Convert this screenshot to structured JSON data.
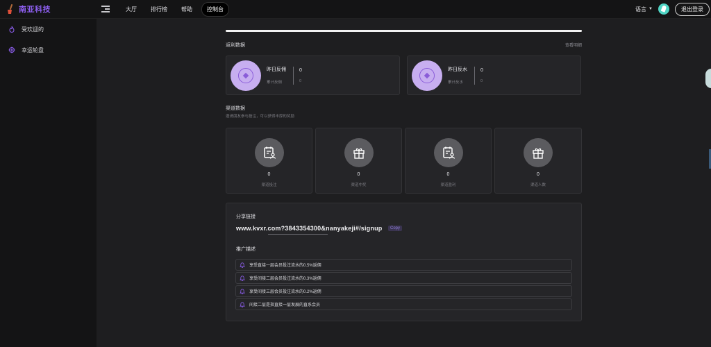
{
  "header": {
    "brand_name": "南亚科技",
    "nav": [
      {
        "label": "大厅",
        "active": false
      },
      {
        "label": "排行榜",
        "active": false
      },
      {
        "label": "帮助",
        "active": false
      },
      {
        "label": "控制台",
        "active": true
      }
    ],
    "language_label": "语言",
    "logout_label": "退出登录"
  },
  "sidebar": {
    "items": [
      {
        "label": "受欢迎的",
        "icon": "flame-icon"
      },
      {
        "label": "幸运轮盘",
        "icon": "wheel-icon"
      }
    ]
  },
  "main": {
    "progress": 1.0,
    "rebate_section": {
      "title": "返利数据",
      "detail_link": "查看明细",
      "cards": [
        {
          "label": "昨日反佣",
          "sub_label": "累计反佣",
          "value": "0",
          "total": "0"
        },
        {
          "label": "昨日反水",
          "sub_label": "累计反水",
          "value": "0",
          "total": "0"
        }
      ]
    },
    "channel_section": {
      "title": "渠道数据",
      "subtitle": "邀请朋友参与投注，可以获得丰厚的奖励",
      "cards": [
        {
          "value": "0",
          "label": "渠道投注",
          "icon": "clipboard-user-icon"
        },
        {
          "value": "0",
          "label": "渠道中奖",
          "icon": "gift-icon"
        },
        {
          "value": "0",
          "label": "渠道盈利",
          "icon": "clipboard-user-icon"
        },
        {
          "value": "0",
          "label": "渠道人数",
          "icon": "gift-icon"
        }
      ]
    },
    "share_section": {
      "title": "分享链接",
      "link": "www.kvxr.com?3843354300&nanyakeji#/signup",
      "copy_label": "Copy",
      "promo_title": "推广描述",
      "promo_items": [
        "享受直接一层会员投注流水的0.5%返佣",
        "享受间接二层会员投注流水的0.3%返佣",
        "享受间接三层会员投注流水的0.2%返佣",
        "间接二层是指直接一层发展的直系会员"
      ]
    }
  },
  "colors": {
    "accent": "#8e5ff0",
    "rebate_circle": "#c7aef0",
    "background": "#1e1e20",
    "panel": "#252528"
  }
}
